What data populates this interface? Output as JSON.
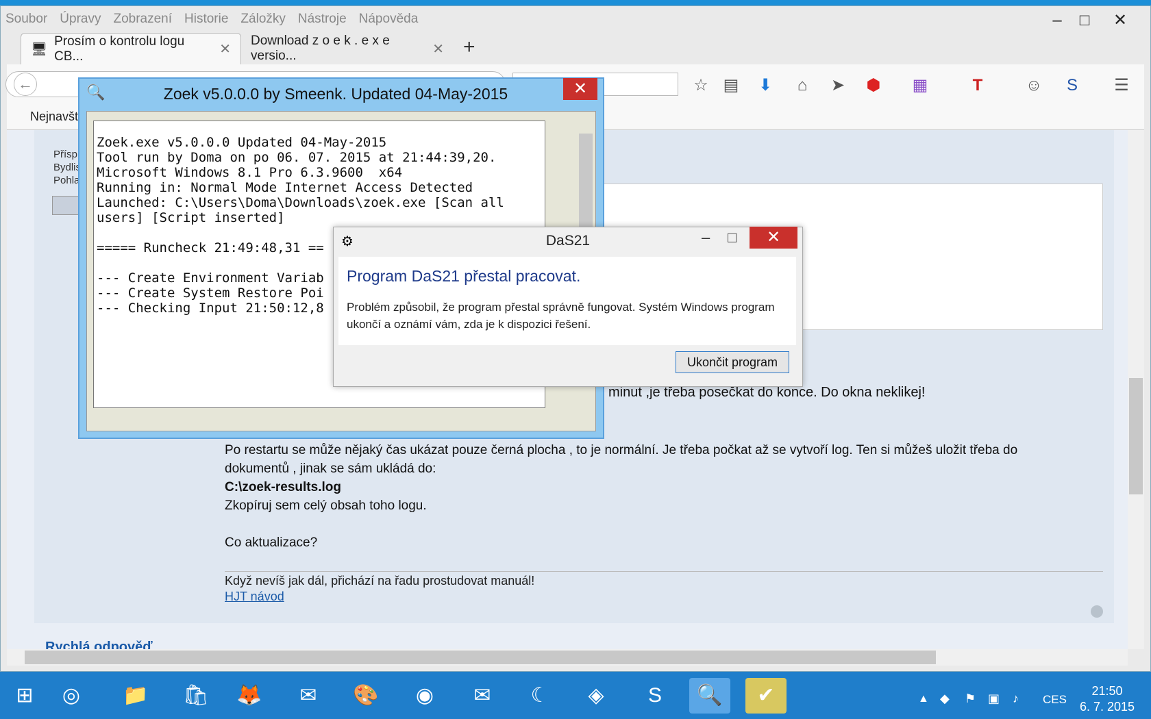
{
  "browser": {
    "menu": [
      "Soubor",
      "Úpravy",
      "Zobrazení",
      "Historie",
      "Záložky",
      "Nástroje",
      "Nápověda"
    ],
    "tabs": [
      {
        "label": "Prosím o kontrolu logu CB..."
      },
      {
        "label": "Download z o e k . e x e versio..."
      }
    ],
    "new_tab": "+",
    "bookmarks_label": "Nejnavšt",
    "toolbar_icons": [
      "star-icon",
      "reading-list-icon",
      "download-icon",
      "home-icon",
      "send-icon",
      "adblock-icon",
      "apps-icon",
      "text-icon",
      "chat-icon",
      "security-icon",
      "menu-icon"
    ]
  },
  "forum": {
    "sidebar_lines": [
      "Přísp",
      "Bydlis",
      "Pohla"
    ],
    "snippet": "minut ,je třeba posečkat do konce. Do okna neklikej!",
    "post_lines": [
      "Po restartu se může nějaký čas ukázat pouze černá plocha , to je normální. Je třeba počkat až se vytvoří log. Ten si můžeš uložit třeba do",
      "dokumentů , jinak se sám ukládá do:",
      "C:\\zoek-results.log",
      "Zkopíruj sem celý obsah toho logu.",
      "",
      "Co aktualizace?"
    ],
    "signature": "Když nevíš jak dál, přichází na řadu prostudovat manuál!",
    "link": "HJT návod",
    "quick_reply": "Rychlá odpověď"
  },
  "zoek": {
    "title": "Zoek v5.0.0.0 by Smeenk. Updated 04-May-2015",
    "log": "Zoek.exe v5.0.0.0 Updated 04-May-2015\nTool run by Doma on po 06. 07. 2015 at 21:44:39,20.\nMicrosoft Windows 8.1 Pro 6.3.9600  x64\nRunning in: Normal Mode Internet Access Detected\nLaunched: C:\\Users\\Doma\\Downloads\\zoek.exe [Scan all\nusers] [Script inserted]\n\n===== Runcheck 21:49:48,31 ==\n\n--- Create Environment Variab\n--- Create System Restore Poi\n--- Checking Input 21:50:12,8"
  },
  "das": {
    "title": "DaS21",
    "heading": "Program DaS21 přestal pracovat.",
    "message": "Problém způsobil, že program přestal správně fungovat. Systém Windows program ukončí a oznámí vám, zda je k dispozici řešení.",
    "button": "Ukončit program"
  },
  "taskbar": {
    "lang": "CES",
    "time": "21:50",
    "date": "6. 7. 2015",
    "apps": [
      "start-icon",
      "task-view-icon",
      "file-explorer-icon",
      "store-icon",
      "firefox-icon",
      "thunderbird-icon",
      "paint-icon",
      "chrome-icon",
      "thunderbird2-icon",
      "ccleaner-icon",
      "network-icon",
      "skype-icon",
      "zoek-icon",
      "das21-icon"
    ]
  }
}
